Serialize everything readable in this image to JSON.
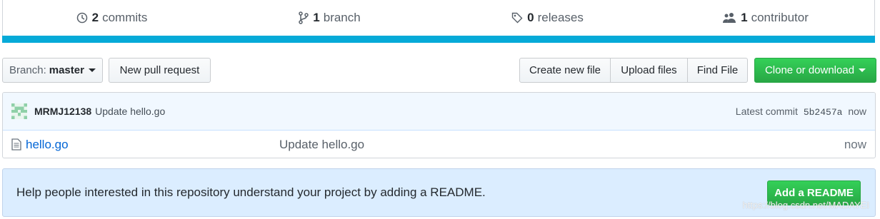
{
  "stats": {
    "commits": {
      "count": "2",
      "label": "commits",
      "icon": "history-icon"
    },
    "branches": {
      "count": "1",
      "label": "branch",
      "icon": "branch-icon"
    },
    "releases": {
      "count": "0",
      "label": "releases",
      "icon": "tag-icon"
    },
    "contributors": {
      "count": "1",
      "label": "contributor",
      "icon": "people-icon"
    },
    "bar_color": "#06aad8"
  },
  "toolbar": {
    "branch_prefix": "Branch:",
    "branch_name": "master",
    "new_pull_request": "New pull request",
    "create_new_file": "Create new file",
    "upload_files": "Upload files",
    "find_file": "Find File",
    "clone_or_download": "Clone or download"
  },
  "commit": {
    "author": "MRMJ12138",
    "message": "Update hello.go",
    "latest_label": "Latest commit",
    "sha": "5b2457a",
    "age": "now"
  },
  "files": [
    {
      "name": "hello.go",
      "message": "Update hello.go",
      "age": "now",
      "icon": "file-icon"
    }
  ],
  "readme": {
    "text": "Help people interested in this repository understand your project by adding a README.",
    "button": "Add a README"
  },
  "watermark": "https://blog.csdn.net/MADAYEI"
}
